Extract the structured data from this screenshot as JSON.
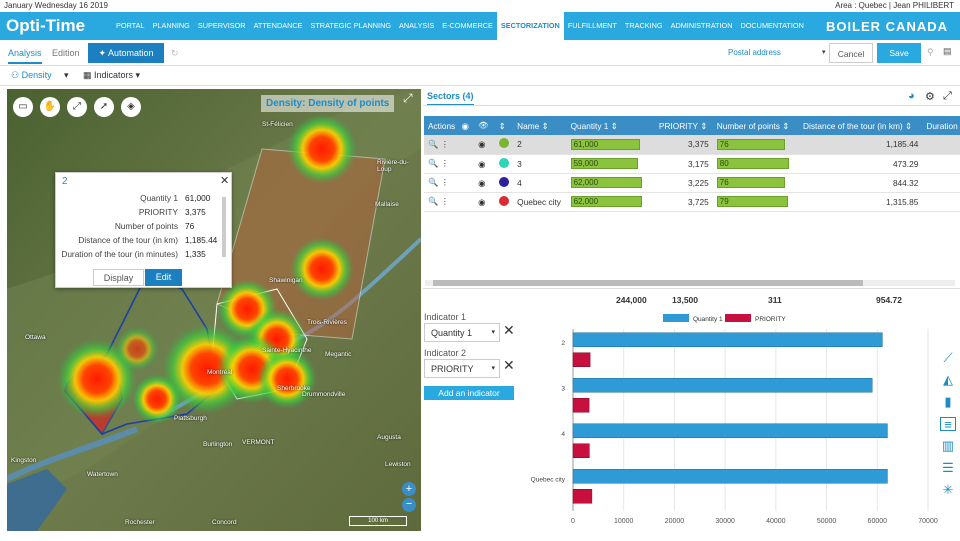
{
  "top_left": "January Wednesday 16 2019",
  "top_right": "Area : Quebec  |  Jean PHILIBERT",
  "logo": "Opti-Time",
  "nav_items": [
    "PORTAL",
    "PLANNING",
    "SUPERVISOR",
    "ATTENDANCE",
    "STRATEGIC PLANNING",
    "ANALYSIS",
    "E-COMMERCE",
    "SECTORIZATION",
    "FULFILLMENT",
    "TRACKING",
    "ADMINISTRATION",
    "DOCUMENTATION"
  ],
  "brand": "BOILER CANADA",
  "tabs": {
    "analysis": "Analysis",
    "edition": "Edition",
    "automation": "Automation"
  },
  "postal": "Postal address",
  "cancel": "Cancel",
  "save": "Save",
  "toolbar": {
    "density": "Density",
    "indicators": "Indicators"
  },
  "map": {
    "title": "Density: Density of points",
    "scale": "100 km",
    "places": [
      "St-Félicien",
      "Rivière-du-Loup",
      "Mallaise",
      "Shawinigan",
      "Trois-Rivières",
      "Ottawa",
      "Montréal",
      "Kingston",
      "Burlington",
      "Plattsburgh",
      "VERMONT",
      "Sherbrooke",
      "Drummondville",
      "Watertown",
      "Lewiston",
      "Augusta",
      "Rochester",
      "Concord",
      "Sainte-Hyacinthe",
      "Megantic"
    ]
  },
  "popup": {
    "title": "2",
    "rows": [
      {
        "k": "Quantity 1",
        "v": "61,000"
      },
      {
        "k": "PRIORITY",
        "v": "3,375"
      },
      {
        "k": "Number of points",
        "v": "76"
      },
      {
        "k": "Distance of the tour (in km)",
        "v": "1,185.44"
      },
      {
        "k": "Duration of the tour (in minutes)",
        "v": "1,335"
      }
    ],
    "display": "Display",
    "edit": "Edit"
  },
  "sectors_title": "Sectors (4)",
  "columns": [
    "Actions",
    "",
    "",
    "Name",
    "Quantity 1",
    "PRIORITY",
    "Number of points",
    "Distance of the tour (in km)",
    "Duration of th"
  ],
  "rows": [
    {
      "name": "2",
      "color": "#7ab531",
      "q": "61,000",
      "qf": 0.87,
      "p": "3,375",
      "n": "76",
      "nf": 0.87,
      "d": "1,185.44"
    },
    {
      "name": "3",
      "color": "#2dd4b6",
      "q": "59,000",
      "qf": 0.84,
      "p": "3,175",
      "n": "80",
      "nf": 0.92,
      "d": "473.29"
    },
    {
      "name": "4",
      "color": "#2d1f9e",
      "q": "62,000",
      "qf": 0.89,
      "p": "3,225",
      "n": "76",
      "nf": 0.87,
      "d": "844.32"
    },
    {
      "name": "Quebec city",
      "color": "#d82b33",
      "q": "62,000",
      "qf": 0.89,
      "p": "3,725",
      "n": "79",
      "nf": 0.91,
      "d": "1,315.85"
    }
  ],
  "totals": {
    "q": "244,000",
    "p": "13,500",
    "n": "311",
    "d": "954.72"
  },
  "indicator1_label": "Indicator 1",
  "indicator1": "Quantity 1",
  "indicator2_label": "Indicator 2",
  "indicator2": "PRIORITY",
  "add_indicator": "Add an indicator",
  "chart_data": {
    "type": "bar",
    "orientation": "horizontal",
    "categories": [
      "2",
      "3",
      "4",
      "Quebec city"
    ],
    "series": [
      {
        "name": "Quantity 1",
        "color": "#2e9bd6",
        "values": [
          61000,
          59000,
          62000,
          62000
        ]
      },
      {
        "name": "PRIORITY",
        "color": "#c8103e",
        "values": [
          3375,
          3175,
          3225,
          3725
        ]
      }
    ],
    "xlim": [
      0,
      70000
    ],
    "xticks": [
      0,
      10000,
      20000,
      30000,
      40000,
      50000,
      60000,
      70000
    ],
    "legend": "top"
  }
}
